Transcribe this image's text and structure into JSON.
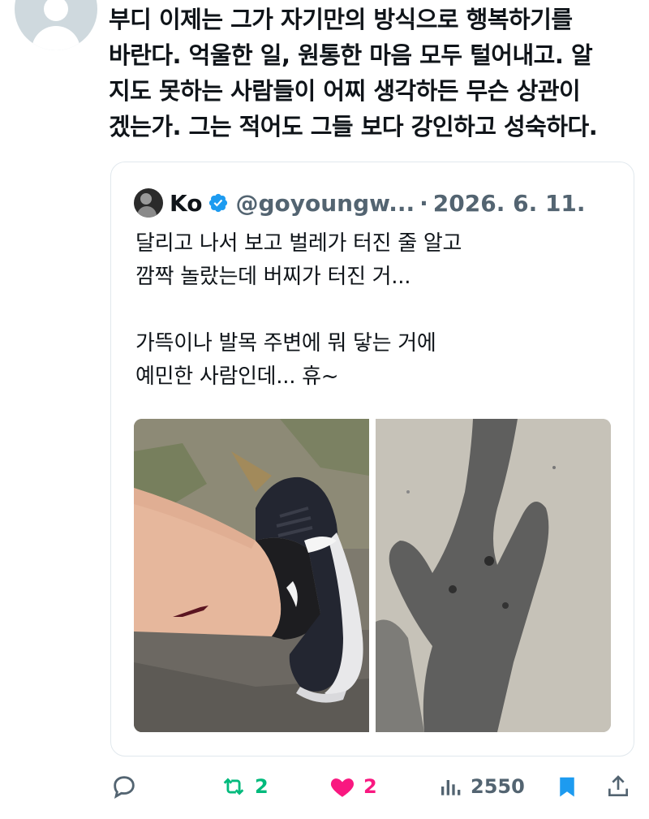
{
  "reply": {
    "avatar_icon": "default-profile-icon",
    "text": "부디 이제는 그가 자기만의 방식으로 행복하기를\n바란다. 억울한 일, 원통한 마음 모두 털어내고. 알\n지도 못하는 사람들이 어찌 생각하든 무슨 상관이\n겠는가. 그는 적어도 그들 보다 강인하고 성숙하다."
  },
  "quoted_tweet": {
    "name": "Ko",
    "handle": "@goyoungw...",
    "separator": "·",
    "date": "2026. 6. 11.",
    "verified_icon": "verified-badge-icon",
    "text": "달리고 나서 보고 벌레가 터진 줄 알고\n깜짝 놀랐는데 버찌가 터진 거...\n\n가뜩이나 발목 주변에 뭐 닿는 거에\n예민한 사람인데... 휴~",
    "media": [
      "ankle-photo",
      "shadow-photo"
    ]
  },
  "actions": {
    "reply_icon": "reply-icon",
    "retweet_count": "2",
    "like_count": "2",
    "views_count": "2550",
    "bookmark_icon": "bookmark-icon",
    "share_icon": "share-icon"
  },
  "colors": {
    "text": "#0f1419",
    "secondary": "#536471",
    "retweet": "#00ba7c",
    "like": "#f91880",
    "accent": "#1d9bf0"
  }
}
